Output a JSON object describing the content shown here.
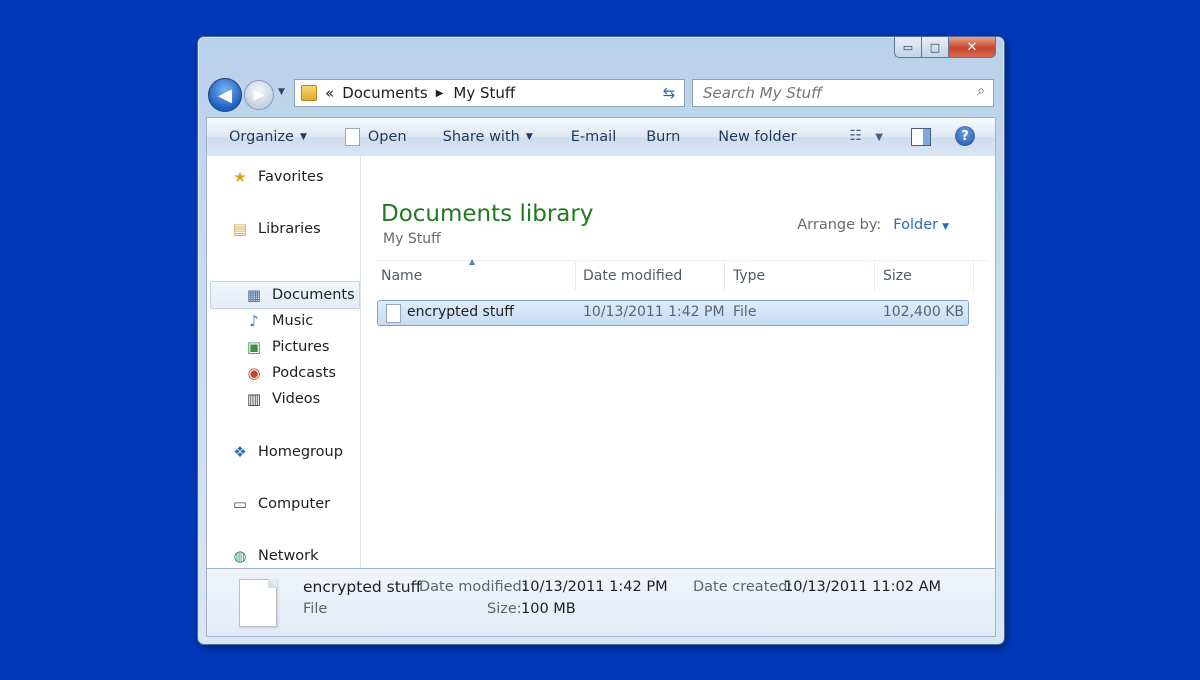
{
  "window": {
    "caption": {
      "minimize": "▭",
      "maximize": "□",
      "close": "✕"
    }
  },
  "nav": {
    "breadcrumb_overflow": "«",
    "breadcrumbs": [
      "Documents",
      "My Stuff"
    ],
    "search_placeholder": "Search My Stuff"
  },
  "toolbar": {
    "organize": "Organize",
    "open": "Open",
    "share_with": "Share with",
    "email": "E-mail",
    "burn": "Burn",
    "new_folder": "New folder"
  },
  "sidebar": {
    "favorites": "Favorites",
    "libraries": "Libraries",
    "documents": "Documents",
    "music": "Music",
    "pictures": "Pictures",
    "podcasts": "Podcasts",
    "videos": "Videos",
    "homegroup": "Homegroup",
    "computer": "Computer",
    "network": "Network"
  },
  "main": {
    "title": "Documents library",
    "subtitle": "My Stuff",
    "arrange_label": "Arrange by:",
    "arrange_value": "Folder",
    "columns": {
      "name": "Name",
      "date": "Date modified",
      "type": "Type",
      "size": "Size"
    },
    "files": [
      {
        "name": "encrypted stuff",
        "date": "10/13/2011 1:42 PM",
        "type": "File",
        "size": "102,400 KB"
      }
    ]
  },
  "details": {
    "name": "encrypted stuff",
    "type": "File",
    "date_modified_label": "Date modified:",
    "date_modified": "10/13/2011 1:42 PM",
    "date_created_label": "Date created:",
    "date_created": "10/13/2011 11:02 AM",
    "size_label": "Size:",
    "size": "100 MB"
  },
  "colors": {
    "desktop": "#0038b8",
    "library_title": "#1f7a1f",
    "link": "#2b6ac0"
  }
}
